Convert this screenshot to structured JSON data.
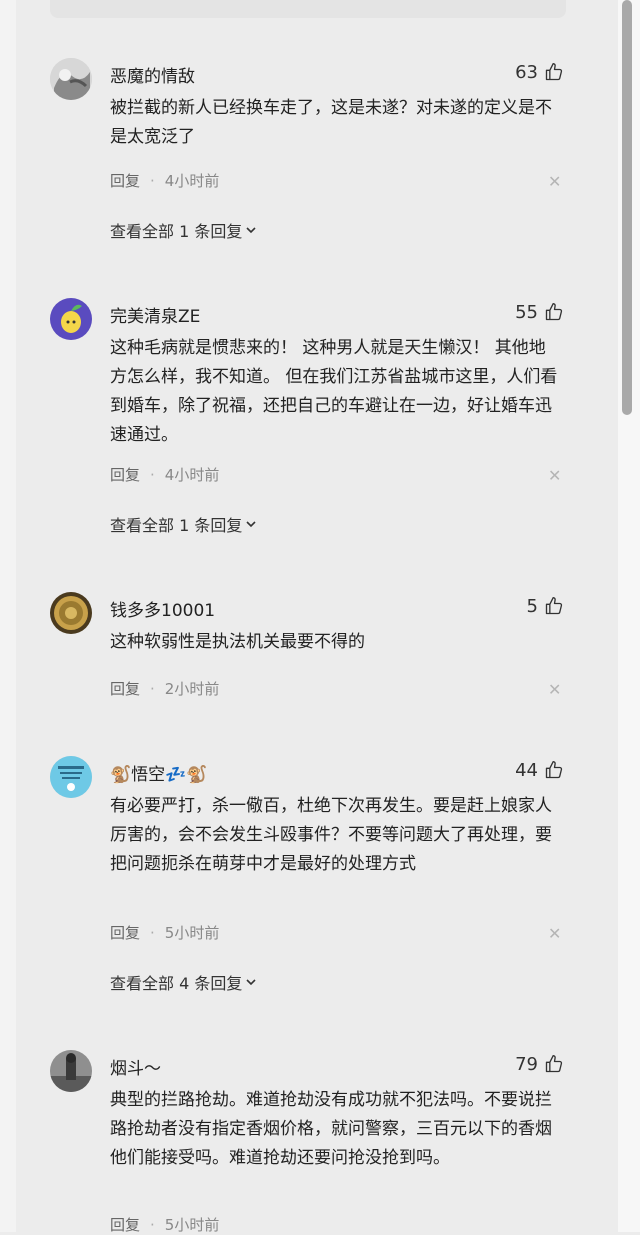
{
  "comments": [
    {
      "username": "恶魔的情敌",
      "likes": "63",
      "text": "被拦截的新人已经换车走了，这是未遂？对未遂的定义是不是太宽泛了",
      "reply_label": "回复",
      "time": "4小时前",
      "view_replies": "查看全部 1 条回复"
    },
    {
      "username": "完美清泉ZE",
      "likes": "55",
      "text": "这种毛病就是惯悲来的！ 这种男人就是天生懒汉！ 其他地方怎么样，我不知道。 但在我们江苏省盐城市这里，人们看到婚车，除了祝福，还把自己的车避让在一边，好让婚车迅速通过。",
      "reply_label": "回复",
      "time": "4小时前",
      "view_replies": "查看全部 1 条回复"
    },
    {
      "username": "钱多多10001",
      "likes": "5",
      "text": "这种软弱性是执法机关最要不得的",
      "reply_label": "回复",
      "time": "2小时前"
    },
    {
      "username": "🐒悟空💤🐒",
      "likes": "44",
      "text": "有必要严打，杀一儆百，杜绝下次再发生。要是赶上娘家人厉害的，会不会发生斗殴事件？不要等问题大了再处理，要把问题扼杀在萌芽中才是最好的处理方式",
      "reply_label": "回复",
      "time": "5小时前",
      "view_replies": "查看全部 4 条回复"
    },
    {
      "username": "烟斗～",
      "likes": "79",
      "text": "典型的拦路抢劫。难道抢劫没有成功就不犯法吗。不要说拦路抢劫者没有指定香烟价格，就问警察，三百元以下的香烟他们能接受吗。难道抢劫还要问抢没抢到吗。",
      "reply_label": "回复",
      "time": "5小时前"
    }
  ],
  "icons": {
    "like": "thumbs-up-icon",
    "close": "close-icon",
    "expand": "chevron-down-icon"
  }
}
